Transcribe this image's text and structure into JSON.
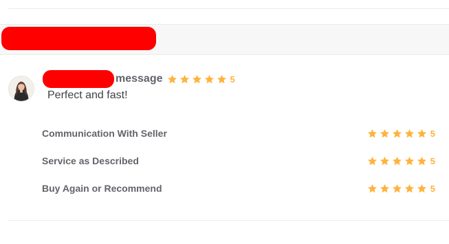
{
  "review": {
    "name_suffix": "message",
    "rating": "5",
    "comment": "Perfect and fast!"
  },
  "breakdown": [
    {
      "label": "Communication With Seller",
      "score": "5"
    },
    {
      "label": "Service as Described",
      "score": "5"
    },
    {
      "label": "Buy Again or Recommend",
      "score": "5"
    }
  ],
  "colors": {
    "star": "#ffb33e",
    "text_muted": "#62646a",
    "text_body": "#404145",
    "redaction": "#ff0000"
  },
  "icons": {
    "star": "star-icon",
    "avatar": "reviewer-avatar"
  }
}
